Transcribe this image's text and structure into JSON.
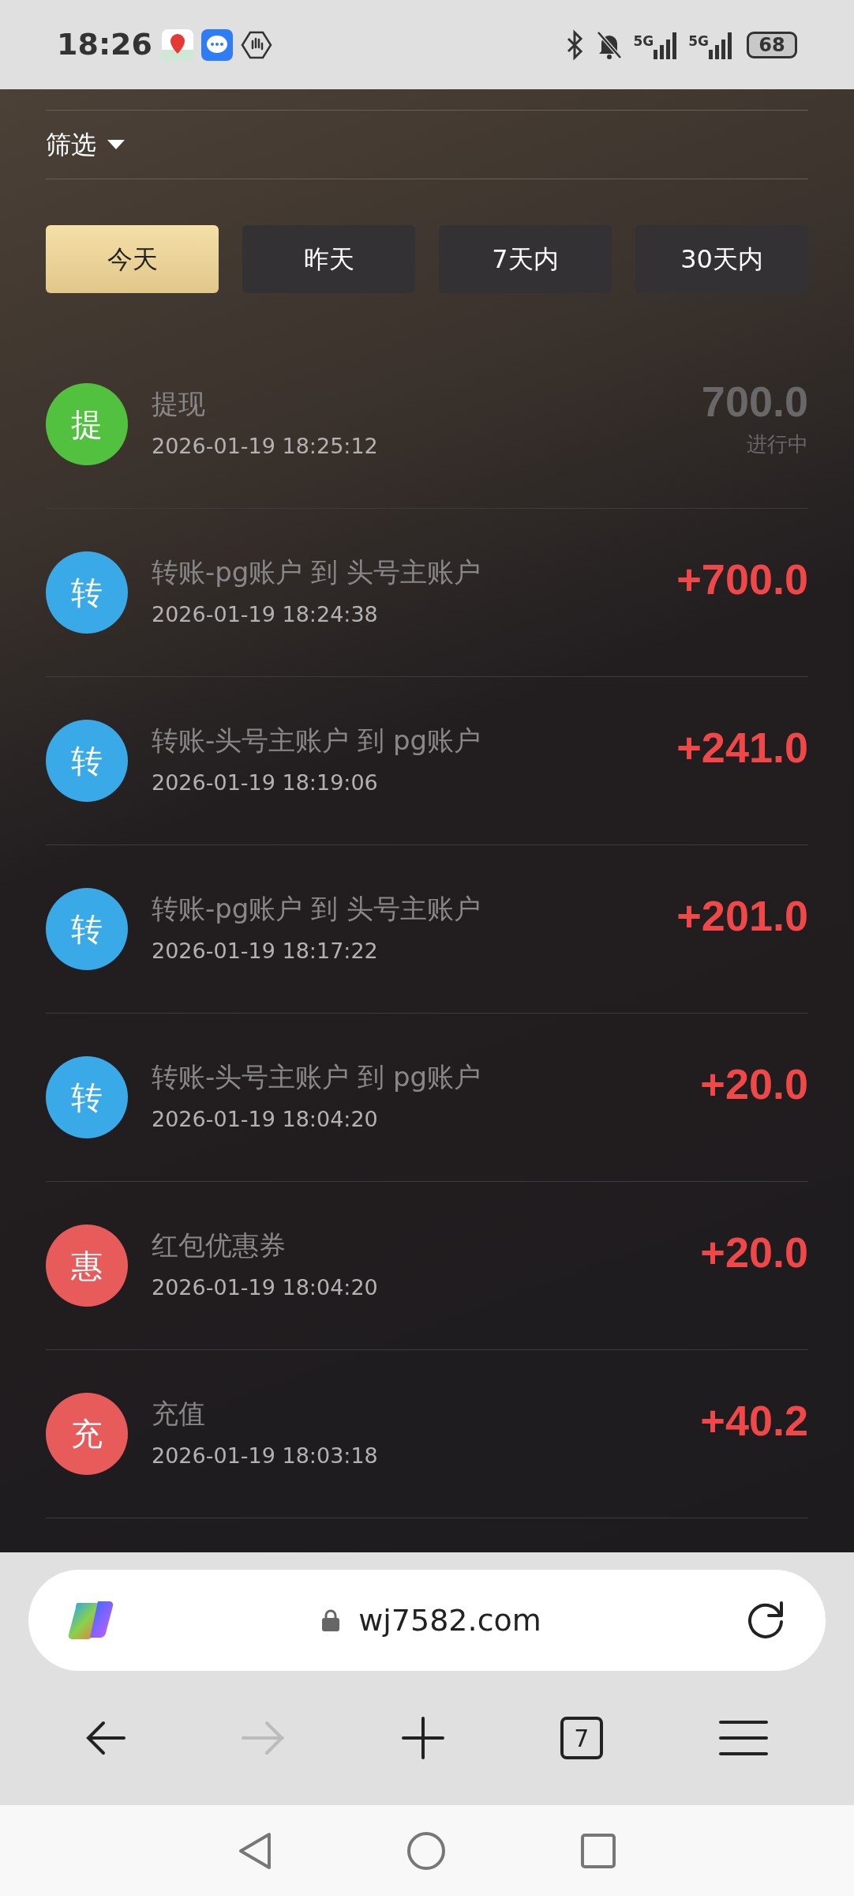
{
  "status_bar": {
    "time": "18:26",
    "network_1": "5G",
    "network_2": "5G",
    "battery": "68"
  },
  "filter": {
    "label": "筛选"
  },
  "tabs": [
    {
      "label": "今天",
      "selected": true
    },
    {
      "label": "昨天",
      "selected": false
    },
    {
      "label": "7天内",
      "selected": false
    },
    {
      "label": "30天内",
      "selected": false
    }
  ],
  "transactions": [
    {
      "kind": "pending",
      "badge": "提",
      "color": "#52c13f",
      "title": "提现",
      "time": "2026-01-19 18:25:12",
      "amount": "700.0",
      "status": "进行中"
    },
    {
      "kind": "credit",
      "badge": "转",
      "color": "#3aa9e8",
      "title": "转账-pg账户 到 头号主账户",
      "time": "2026-01-19 18:24:38",
      "amount": "+700.0"
    },
    {
      "kind": "credit",
      "badge": "转",
      "color": "#3aa9e8",
      "title": "转账-头号主账户 到 pg账户",
      "time": "2026-01-19 18:19:06",
      "amount": "+241.0"
    },
    {
      "kind": "credit",
      "badge": "转",
      "color": "#3aa9e8",
      "title": "转账-pg账户 到 头号主账户",
      "time": "2026-01-19 18:17:22",
      "amount": "+201.0"
    },
    {
      "kind": "credit",
      "badge": "转",
      "color": "#3aa9e8",
      "title": "转账-头号主账户 到 pg账户",
      "time": "2026-01-19 18:04:20",
      "amount": "+20.0"
    },
    {
      "kind": "credit",
      "badge": "惠",
      "color": "#e85b5b",
      "title": "红包优惠券",
      "time": "2026-01-19 18:04:20",
      "amount": "+20.0"
    },
    {
      "kind": "credit",
      "badge": "充",
      "color": "#e85b5b",
      "title": "充值",
      "time": "2026-01-19 18:03:18",
      "amount": "+40.2"
    }
  ],
  "browser": {
    "url": "wj7582.com",
    "tab_count": "7"
  }
}
